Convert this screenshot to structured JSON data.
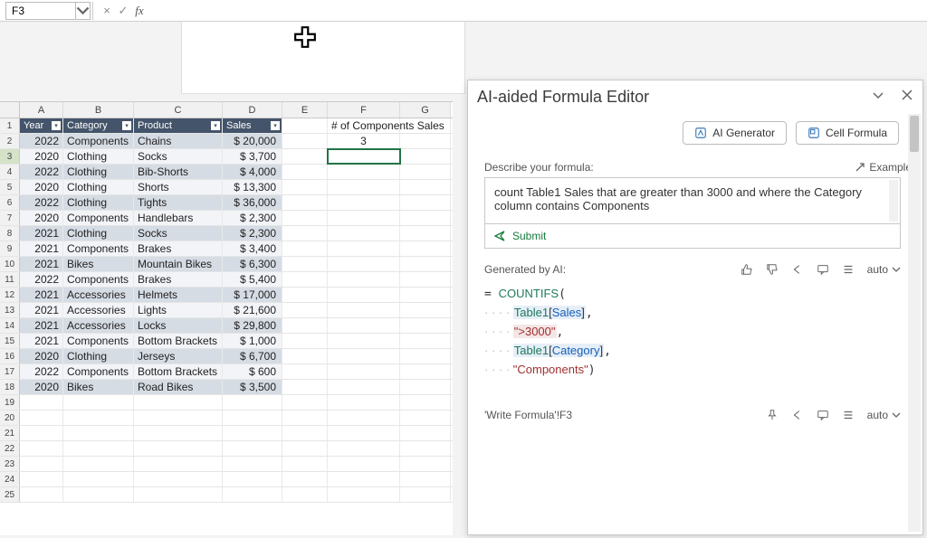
{
  "formula_bar": {
    "name_box": "F3",
    "cancel": "×",
    "confirm": "✓",
    "fx": "fx"
  },
  "columns": [
    "A",
    "B",
    "C",
    "D",
    "E",
    "F",
    "G"
  ],
  "table_headers": {
    "a": "Year",
    "b": "Category",
    "c": "Product",
    "d": "Sales"
  },
  "rows": [
    {
      "y": "2022",
      "cat": "Components",
      "prod": "Chains",
      "sales": "$ 20,000"
    },
    {
      "y": "2020",
      "cat": "Clothing",
      "prod": "Socks",
      "sales": "$  3,700"
    },
    {
      "y": "2022",
      "cat": "Clothing",
      "prod": "Bib-Shorts",
      "sales": "$  4,000"
    },
    {
      "y": "2020",
      "cat": "Clothing",
      "prod": "Shorts",
      "sales": "$ 13,300"
    },
    {
      "y": "2022",
      "cat": "Clothing",
      "prod": "Tights",
      "sales": "$ 36,000"
    },
    {
      "y": "2020",
      "cat": "Components",
      "prod": "Handlebars",
      "sales": "$  2,300"
    },
    {
      "y": "2021",
      "cat": "Clothing",
      "prod": "Socks",
      "sales": "$  2,300"
    },
    {
      "y": "2021",
      "cat": "Components",
      "prod": "Brakes",
      "sales": "$  3,400"
    },
    {
      "y": "2021",
      "cat": "Bikes",
      "prod": "Mountain Bikes",
      "sales": "$  6,300"
    },
    {
      "y": "2022",
      "cat": "Components",
      "prod": "Brakes",
      "sales": "$  5,400"
    },
    {
      "y": "2021",
      "cat": "Accessories",
      "prod": "Helmets",
      "sales": "$ 17,000"
    },
    {
      "y": "2021",
      "cat": "Accessories",
      "prod": "Lights",
      "sales": "$ 21,600"
    },
    {
      "y": "2021",
      "cat": "Accessories",
      "prod": "Locks",
      "sales": "$ 29,800"
    },
    {
      "y": "2021",
      "cat": "Components",
      "prod": "Bottom Brackets",
      "sales": "$  1,000"
    },
    {
      "y": "2020",
      "cat": "Clothing",
      "prod": "Jerseys",
      "sales": "$  6,700"
    },
    {
      "y": "2022",
      "cat": "Components",
      "prod": "Bottom Brackets",
      "sales": "$    600"
    },
    {
      "y": "2020",
      "cat": "Bikes",
      "prod": "Road Bikes",
      "sales": "$  3,500"
    }
  ],
  "side_cells": {
    "F1": "# of Components Sales",
    "F2": "3"
  },
  "selected_cell": "F3",
  "panel": {
    "title": "AI-aided Formula Editor",
    "btn_ai": "AI Generator",
    "btn_cell": "Cell Formula",
    "describe_label": "Describe your formula:",
    "examples": "Examples",
    "describe_text": "count Table1 Sales that are greater than 3000 and where the Category column contains Components",
    "submit": "Submit",
    "generated_label": "Generated by AI:",
    "auto": "auto",
    "formula": {
      "fn": "COUNTIFS",
      "arg1_obj": "Table1",
      "arg1_fld": "Sales",
      "arg2": "\">3000\"",
      "arg3_obj": "Table1",
      "arg3_fld": "Category",
      "arg4": "\"Components\""
    },
    "ref_label": "'Write Formula'!F3"
  }
}
